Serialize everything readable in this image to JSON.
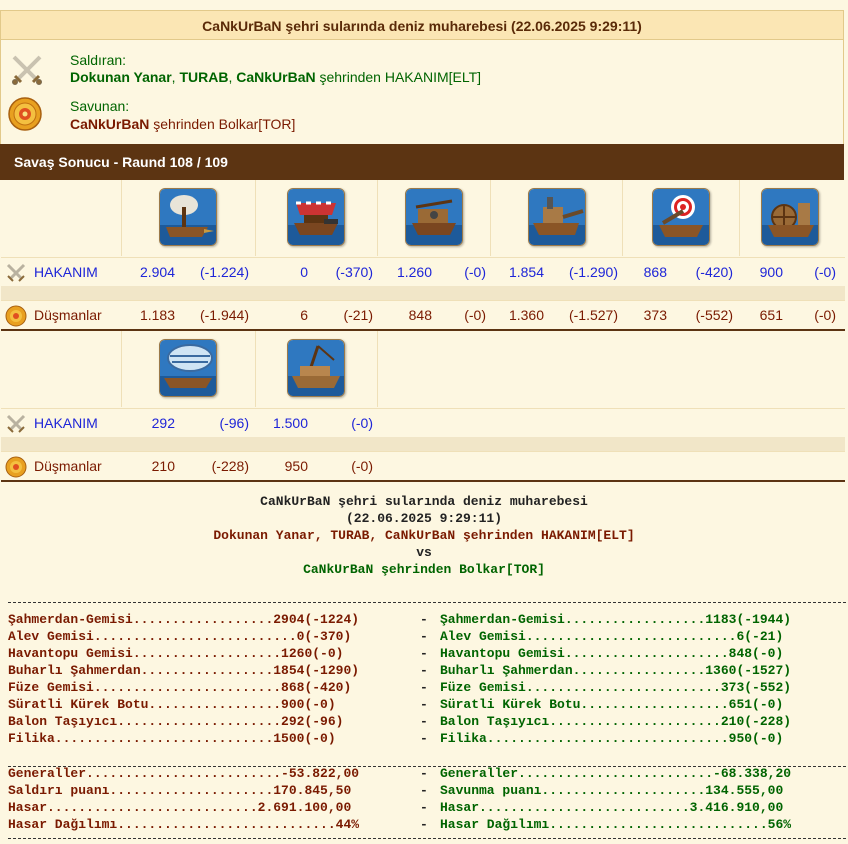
{
  "title": "CaNkUrBaN şehri sularında deniz muharebesi (22.06.2025 9:29:11)",
  "attacker": {
    "label": "Saldıran:",
    "players": [
      "Dokunan Yanar",
      "TURAB",
      "CaNkUrBaN"
    ],
    "sep1": ", ",
    "sep2": ", ",
    "suffix": " şehrinden HAKANIM[ELT]"
  },
  "defender": {
    "label": "Savunan:",
    "player": "CaNkUrBaN",
    "suffix": " şehrinden Bolkar[TOR]"
  },
  "result_header": "Savaş Sonucu - Raund 108 / 109",
  "rows": {
    "attacker_name": "HAKANIM",
    "defender_name": "Düşmanlar"
  },
  "units_top": [
    {
      "icon": "ram-ship-icon",
      "att": "2.904",
      "att_loss": "(-1.224)",
      "def": "1.183",
      "def_loss": "(-1.944)"
    },
    {
      "icon": "fire-ship-icon",
      "att": "0",
      "att_loss": "(-370)",
      "def": "6",
      "def_loss": "(-21)"
    },
    {
      "icon": "ballista-ship-icon",
      "att": "1.260",
      "att_loss": "(-0)",
      "def": "848",
      "def_loss": "(-0)"
    },
    {
      "icon": "steam-ram-icon",
      "att": "1.854",
      "att_loss": "(-1.290)",
      "def": "1.360",
      "def_loss": "(-1.527)"
    },
    {
      "icon": "rocket-ship-icon",
      "att": "868",
      "att_loss": "(-420)",
      "def": "373",
      "def_loss": "(-552)"
    },
    {
      "icon": "paddle-speedboat-icon",
      "att": "900",
      "att_loss": "(-0)",
      "def": "651",
      "def_loss": "(-0)"
    }
  ],
  "units_bottom": [
    {
      "icon": "balloon-carrier-icon",
      "att": "292",
      "att_loss": "(-96)",
      "def": "210",
      "def_loss": "(-228)"
    },
    {
      "icon": "tender-icon",
      "att": "1.500",
      "att_loss": "(-0)",
      "def": "950",
      "def_loss": "(-0)"
    }
  ],
  "report": {
    "title": "CaNkUrBaN şehri sularında deniz muharebesi",
    "date": "(22.06.2025 9:29:11)",
    "attackers": "Dokunan Yanar, TURAB, CaNkUrBaN şehrinden HAKANIM[ELT]",
    "vs": "vs",
    "defenders": "CaNkUrBaN şehrinden Bolkar[TOR]",
    "dashes": "-------------------------------------------------------------------------------------------------------------------",
    "units": [
      {
        "left": "Şahmerdan-Gemisi..................2904(-1224)",
        "right": "Şahmerdan-Gemisi..................1183(-1944)"
      },
      {
        "left": "Alev Gemisi..........................0(-370)",
        "right": "Alev Gemisi...........................6(-21)"
      },
      {
        "left": "Havantopu Gemisi...................1260(-0)",
        "right": "Havantopu Gemisi.....................848(-0)"
      },
      {
        "left": "Buharlı Şahmerdan.................1854(-1290)",
        "right": "Buharlı Şahmerdan.................1360(-1527)"
      },
      {
        "left": "Füze Gemisi........................868(-420)",
        "right": "Füze Gemisi.........................373(-552)"
      },
      {
        "left": "Süratli Kürek Botu.................900(-0)",
        "right": "Süratli Kürek Botu...................651(-0)"
      },
      {
        "left": "Balon Taşıyıcı.....................292(-96)",
        "right": "Balon Taşıyıcı......................210(-228)"
      },
      {
        "left": "Filika............................1500(-0)",
        "right": "Filika...............................950(-0)"
      }
    ],
    "stats": [
      {
        "left": "Generaller.........................-53.822,00",
        "right": "Generaller.........................-68.338,20"
      },
      {
        "left": "Saldırı puanı.....................170.845,50",
        "right": "Savunma puanı.....................134.555,00"
      },
      {
        "left": "Hasar...........................2.691.100,00",
        "right": "Hasar...........................3.416.910,00"
      },
      {
        "left": "Hasar Dağılımı............................44%",
        "right": "Hasar Dağılımı............................56%"
      }
    ],
    "sep_mark": "-"
  }
}
